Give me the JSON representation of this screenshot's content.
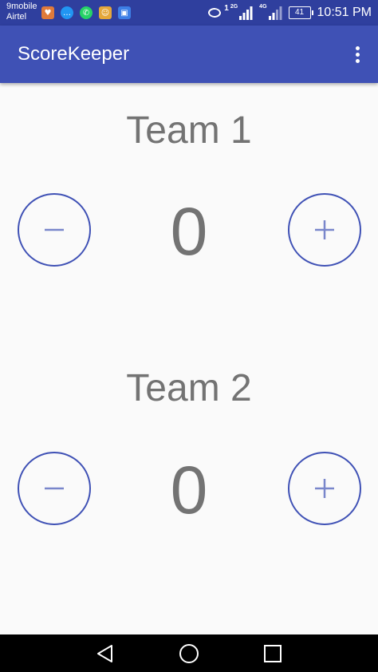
{
  "status_bar": {
    "carrier_1": "9mobile",
    "carrier_2": "Airtel",
    "sim_number": "1",
    "net_type_1": "2G",
    "net_type_2": "4G",
    "battery_level": "41",
    "time": "10:51 PM",
    "notification_icons": [
      "likee-icon",
      "messages-icon",
      "whatsapp-icon",
      "store-icon",
      "browser-icon"
    ]
  },
  "app_bar": {
    "title": "ScoreKeeper",
    "menu_icon": "overflow-menu-icon"
  },
  "teams": [
    {
      "name": "Team 1",
      "score": "0"
    },
    {
      "name": "Team 2",
      "score": "0"
    }
  ],
  "nav_bar": {
    "icons": [
      "back-icon",
      "home-icon",
      "recents-icon"
    ]
  },
  "colors": {
    "primary": "#3f51b5",
    "primary_dark": "#2f3f9e",
    "text_gray": "#737373",
    "background": "#fafafa"
  }
}
